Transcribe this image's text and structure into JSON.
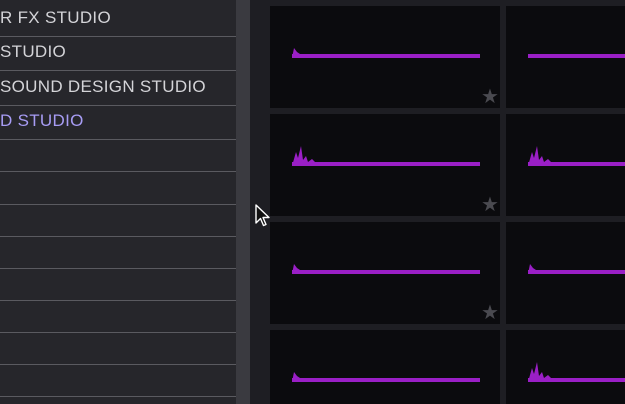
{
  "sidebar": {
    "items": [
      {
        "label": "R FX STUDIO",
        "active": false
      },
      {
        "label": "STUDIO",
        "active": false
      },
      {
        "label": " SOUND DESIGN STUDIO",
        "active": false
      },
      {
        "label": "D STUDIO",
        "active": false
      },
      {
        "label": "",
        "active": false
      },
      {
        "label": "",
        "active": false
      },
      {
        "label": "",
        "active": false
      },
      {
        "label": "",
        "active": false
      },
      {
        "label": "",
        "active": false
      },
      {
        "label": "",
        "active": false
      },
      {
        "label": "",
        "active": false
      },
      {
        "label": "",
        "active": false
      }
    ]
  },
  "tiles": [
    {
      "waveform": "short",
      "favorite_icon": "star-icon"
    },
    {
      "waveform": "flat",
      "favorite_icon": "star-icon"
    },
    {
      "waveform": "burst",
      "favorite_icon": "star-icon"
    },
    {
      "waveform": "burst",
      "favorite_icon": "star-icon"
    },
    {
      "waveform": "short",
      "favorite_icon": "star-icon"
    },
    {
      "waveform": "short",
      "favorite_icon": "star-icon"
    },
    {
      "waveform": "short",
      "favorite_icon": "star-icon"
    },
    {
      "waveform": "burst",
      "favorite_icon": "star-icon"
    }
  ],
  "colors": {
    "waveform": "#9a1fc6",
    "active_text": "#a79cf4",
    "tile_bg": "#0b0b0e"
  }
}
